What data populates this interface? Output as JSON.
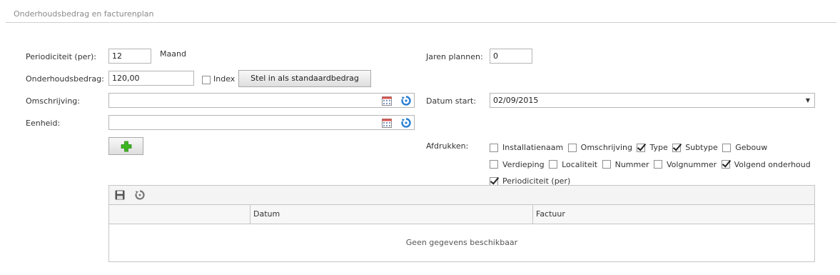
{
  "section": {
    "title": "Onderhoudsbedrag en facturenplan"
  },
  "form": {
    "periodiciteit": {
      "label": "Periodiciteit (per):",
      "value": "12",
      "unit": "Maand"
    },
    "onderhoudsbedrag": {
      "label": "Onderhoudsbedrag:",
      "value": "120,00",
      "index_label": "Index",
      "index_checked": false,
      "default_button": "Stel in als standaardbedrag"
    },
    "omschrijving": {
      "label": "Omschrijving:",
      "value": ""
    },
    "eenheid": {
      "label": "Eenheid:",
      "value": ""
    },
    "jaren_plannen": {
      "label": "Jaren plannen:",
      "value": "0"
    },
    "datum_start": {
      "label": "Datum start:",
      "value": "02/09/2015"
    },
    "afdrukken": {
      "label": "Afdrukken:",
      "options": [
        {
          "label": "Installatienaam",
          "checked": false
        },
        {
          "label": "Omschrijving",
          "checked": false
        },
        {
          "label": "Type",
          "checked": true
        },
        {
          "label": "Subtype",
          "checked": true
        },
        {
          "label": "Gebouw",
          "checked": false
        },
        {
          "label": "Verdieping",
          "checked": false
        },
        {
          "label": "Localiteit",
          "checked": false
        },
        {
          "label": "Nummer",
          "checked": false
        },
        {
          "label": "Volgnummer",
          "checked": false
        },
        {
          "label": "Volgend onderhoud",
          "checked": true
        },
        {
          "label": "Periodiciteit (per)",
          "checked": true
        }
      ]
    }
  },
  "grid": {
    "columns": [
      "",
      "Datum",
      "Factuur"
    ],
    "empty_text": "Geen gegevens beschikbaar"
  },
  "icons": {
    "calendar": "calendar-icon",
    "refresh": "refresh-icon",
    "add": "plus-icon",
    "save": "save-icon"
  },
  "colors": {
    "accent_blue": "#2a7fd4",
    "add_green": "#3cb521"
  }
}
